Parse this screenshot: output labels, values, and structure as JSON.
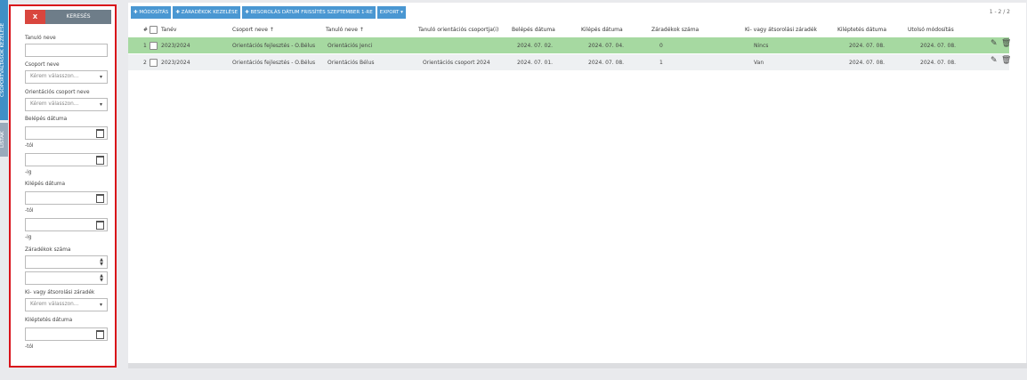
{
  "side_tabs": [
    "CSOPORTVÁLTÁSOK KEZELÉSE",
    "LISTÁK"
  ],
  "filter": {
    "clear_label": "X",
    "search_label": "KERESÉS",
    "student_name_label": "Tanuló neve",
    "group_name_label": "Csoport neve",
    "group_name_placeholder": "Kérem válasszon...",
    "orientation_group_label": "Orientációs csoport neve",
    "orientation_group_placeholder": "Kérem válasszon...",
    "entry_date_label": "Belépés dátuma",
    "from_label": "-tól",
    "to_label": "-ig",
    "exit_date_label": "Kilépés dátuma",
    "exit_from_label": "-tól",
    "exit_to_label": "-ig",
    "clause_count_label": "Záradékok száma",
    "transfer_clause_label": "Ki- vagy átsorolási záradék",
    "transfer_clause_placeholder": "Kérem válasszon...",
    "discharge_date_label": "Kiléptetés dátuma",
    "discharge_from_label": "-tól"
  },
  "toolbar": {
    "modify": "MÓDOSÍTÁS",
    "clauses": "ZÁRADÉKOK KEZELÉSE",
    "classification": "BESOROLÁS DÁTUM FRISSÍTÉS SZEPTEMBER 1-RE",
    "export": "EXPORT"
  },
  "pager": "1 - 2 / 2",
  "table": {
    "headers": [
      "#",
      "Tanév",
      "Csoport neve ↑",
      "Tanuló neve ↑",
      "Tanuló orientációs csoportja(i)",
      "Belépés dátuma",
      "Kilépés dátuma",
      "Záradékok száma",
      "Ki- vagy átsorolási záradék",
      "Kiléptetés dátuma",
      "Utolsó módosítás"
    ],
    "rows": [
      [
        "1",
        "2023/2024",
        "Orientációs fejlesztés - O.Bélus",
        "Orientációs Jenci",
        "",
        "2024. 07. 02.",
        "2024. 07. 04.",
        "0",
        "Nincs",
        "2024. 07. 08.",
        "2024. 07. 08."
      ],
      [
        "2",
        "2023/2024",
        "Orientációs fejlesztés - O.Bélus",
        "Orientációs Bélus",
        "Orientációs csoport 2024",
        "2024. 07. 01.",
        "2024. 07. 08.",
        "1",
        "Van",
        "2024. 07. 08.",
        "2024. 07. 08."
      ]
    ]
  },
  "icons": {
    "edit": "pencil-icon",
    "delete": "trash-icon",
    "calendar": "calendar-icon"
  },
  "colors": {
    "accent": "#4a97d2",
    "selected_row": "#a6d9a1",
    "highlight_border": "#d9121a"
  }
}
